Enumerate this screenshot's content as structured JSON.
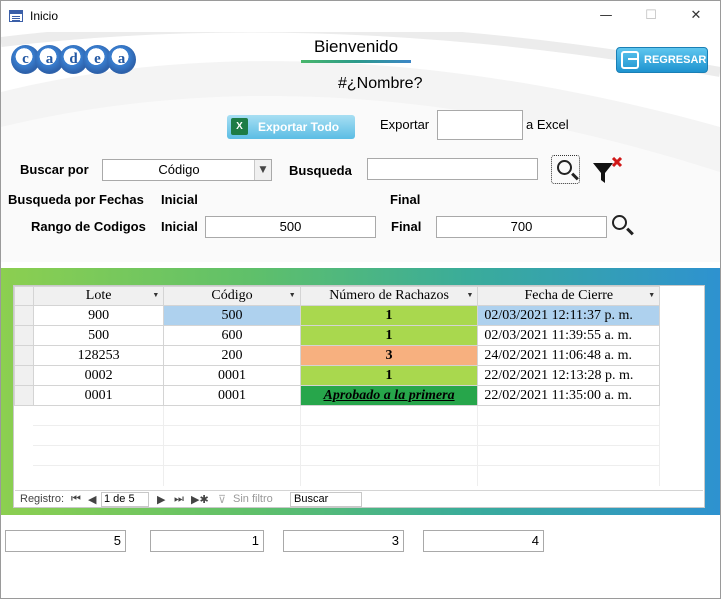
{
  "window": {
    "title": "Inicio",
    "minimize": "—",
    "maximize": "☐",
    "close": "✕"
  },
  "header": {
    "logo_letters": [
      "c",
      "a",
      "d",
      "e",
      "a"
    ],
    "welcome": "Bienvenido",
    "username": "#¿Nombre?",
    "back_button": "REGRESAR"
  },
  "export": {
    "export_all_button": "Exportar Todo",
    "export_label": "Exportar",
    "export_value": "",
    "to_excel_label": "a Excel"
  },
  "search": {
    "buscar_por_label": "Buscar por",
    "buscar_por_value": "Código",
    "busqueda_label": "Busqueda",
    "busqueda_value": ""
  },
  "dates": {
    "label": "Busqueda por Fechas",
    "inicial_label": "Inicial",
    "final_label": "Final"
  },
  "codes": {
    "label": "Rango de Codigos",
    "inicial_label": "Inicial",
    "inicial_value": "500",
    "final_label": "Final",
    "final_value": "700"
  },
  "grid": {
    "columns": [
      "Lote",
      "Código",
      "Número de Rachazos",
      "Fecha de Cierre"
    ],
    "rows": [
      {
        "lote": "900",
        "codigo": "500",
        "rechazos": "1",
        "fecha": "02/03/2021 12:11:37 p. m.",
        "status": "green"
      },
      {
        "lote": "500",
        "codigo": "600",
        "rechazos": "1",
        "fecha": "02/03/2021 11:39:55 a. m.",
        "status": "green"
      },
      {
        "lote": "128253",
        "codigo": "200",
        "rechazos": "3",
        "fecha": "24/02/2021 11:06:48 a. m.",
        "status": "orange"
      },
      {
        "lote": "0002",
        "codigo": "0001",
        "rechazos": "1",
        "fecha": "22/02/2021 12:13:28 p. m.",
        "status": "green"
      },
      {
        "lote": "0001",
        "codigo": "0001",
        "rechazos": "Aprobado a la primera",
        "fecha": "22/02/2021 11:35:00 a. m.",
        "status": "dkgreen"
      }
    ],
    "nav": {
      "registro_label": "Registro:",
      "page": "1 de 5",
      "filter": "Sin filtro",
      "search_placeholder": "Buscar"
    }
  },
  "totals": [
    "5",
    "1",
    "3",
    "4"
  ],
  "colors": {
    "green": "#a9d84e",
    "orange": "#f7b07f",
    "dark_green": "#27a64b",
    "selected_blue": "#aed1ee"
  }
}
